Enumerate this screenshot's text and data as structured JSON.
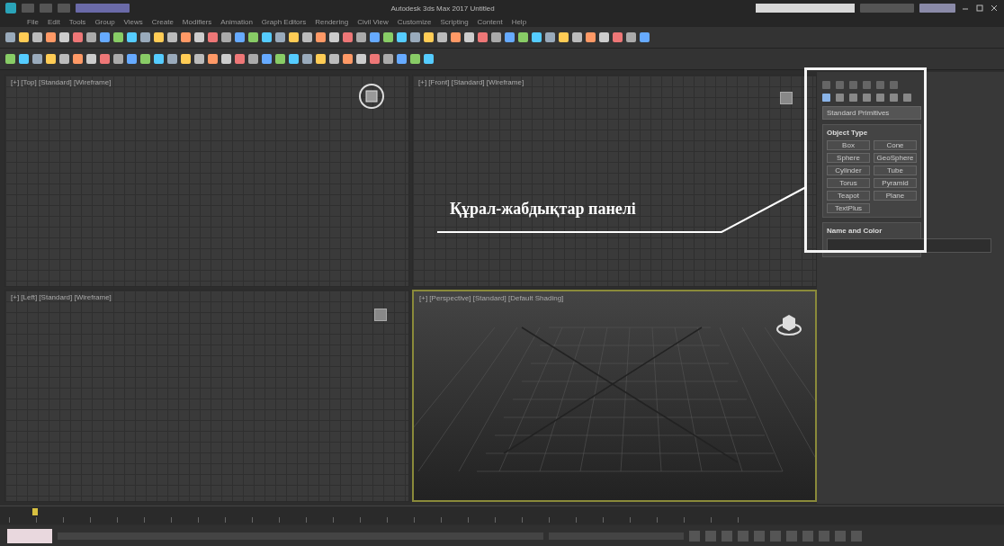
{
  "window": {
    "title": "Autodesk 3ds Max 2017    Untitled"
  },
  "menu": [
    "File",
    "Edit",
    "Tools",
    "Group",
    "Views",
    "Create",
    "Modifiers",
    "Animation",
    "Graph Editors",
    "Rendering",
    "Civil View",
    "Customize",
    "Scripting",
    "Content",
    "Help"
  ],
  "viewports": [
    {
      "label": "[+] [Top] [Standard] [Wireframe]",
      "kind": "ortho",
      "selected": false
    },
    {
      "label": "[+] [Front] [Standard] [Wireframe]",
      "kind": "ortho",
      "selected": false
    },
    {
      "label": "[+] [Left] [Standard] [Wireframe]",
      "kind": "ortho",
      "selected": false
    },
    {
      "label": "[+] [Perspective] [Standard] [Default Shading]",
      "kind": "perspective",
      "selected": true
    }
  ],
  "command_panel": {
    "dropdown": "Standard Primitives",
    "object_type": {
      "title": "Object Type",
      "buttons": [
        "Box",
        "Cone",
        "Sphere",
        "GeoSphere",
        "Cylinder",
        "Tube",
        "Torus",
        "Pyramid",
        "Teapot",
        "Plane",
        "TextPlus"
      ]
    },
    "name_and_color": {
      "title": "Name and Color"
    }
  },
  "annotation": {
    "text": "Құрал-жабдықтар панелі"
  }
}
